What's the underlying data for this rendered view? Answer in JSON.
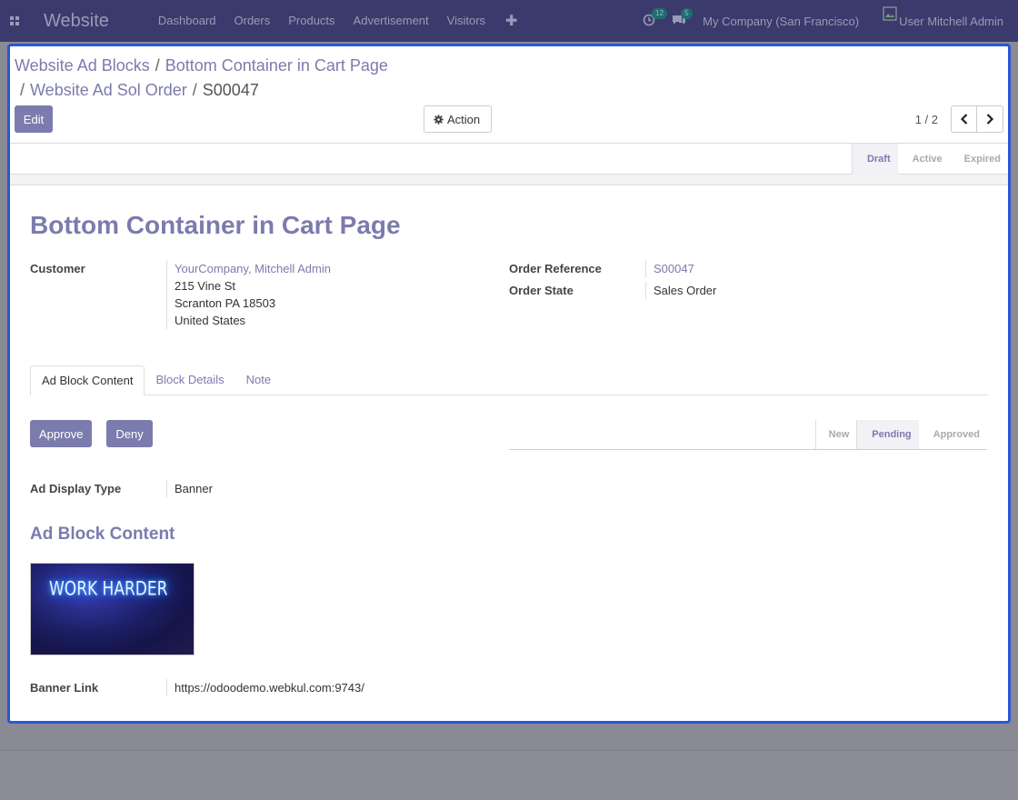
{
  "topbar": {
    "brand": "Website",
    "nav": [
      "Dashboard",
      "Orders",
      "Products",
      "Advertisement",
      "Visitors"
    ],
    "activity_count": "12",
    "messages_count": "5",
    "company": "My Company (San Francisco)",
    "user": "Mitchell Admin",
    "avatar_alt": "User"
  },
  "breadcrumb": {
    "items": [
      "Website Ad Blocks",
      "Bottom Container in Cart Page",
      "Website Ad Sol Order"
    ],
    "current": "S00047"
  },
  "buttons": {
    "edit": "Edit",
    "action": "Action"
  },
  "pager": {
    "value": "1 / 2"
  },
  "status": [
    "Draft",
    "Active",
    "Expired"
  ],
  "record": {
    "title": "Bottom Container in Cart Page",
    "customer_label": "Customer",
    "customer_name": "YourCompany, Mitchell Admin",
    "customer_addr1": "215 Vine St",
    "customer_addr2": "Scranton PA 18503",
    "customer_addr3": "United States",
    "order_ref_label": "Order Reference",
    "order_ref": "S00047",
    "order_state_label": "Order State",
    "order_state": "Sales Order"
  },
  "tabs": [
    "Ad Block Content",
    "Block Details",
    "Note"
  ],
  "content": {
    "approve": "Approve",
    "deny": "Deny",
    "sub_status": [
      "New",
      "Pending",
      "Approved"
    ],
    "display_type_label": "Ad Display Type",
    "display_type": "Banner",
    "section_title": "Ad Block Content",
    "image_text": "WORK HARDER",
    "banner_link_label": "Banner Link",
    "banner_link": "https://odoodemo.webkul.com:9743/"
  },
  "colors": {
    "accent": "#7c7bad",
    "navbar": "#3a3b6c",
    "dialog_border": "#2a57d6"
  }
}
